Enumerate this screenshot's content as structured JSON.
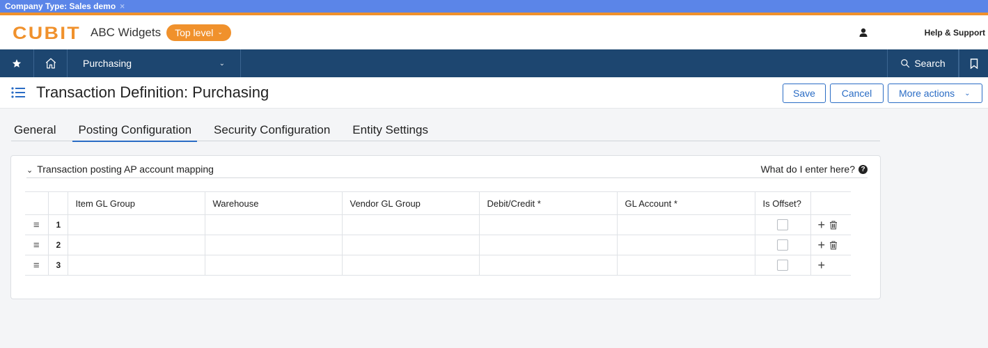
{
  "banner": {
    "text": "Company Type: Sales demo",
    "close": "×"
  },
  "header": {
    "logo": "CUBIT",
    "company": "ABC Widgets",
    "level": "Top level",
    "help": "Help & Support"
  },
  "nav": {
    "module": "Purchasing",
    "search": "Search"
  },
  "page": {
    "title": "Transaction Definition: Purchasing",
    "actions": {
      "save": "Save",
      "cancel": "Cancel",
      "more": "More actions"
    }
  },
  "tabs": [
    "General",
    "Posting Configuration",
    "Security Configuration",
    "Entity Settings"
  ],
  "active_tab": "Posting Configuration",
  "panel": {
    "title": "Transaction posting AP account mapping",
    "help": "What do I enter here?",
    "columns": [
      "Item GL Group",
      "Warehouse",
      "Vendor GL Group",
      "Debit/Credit *",
      "GL Account *",
      "Is Offset?"
    ],
    "rows": [
      {
        "num": "1",
        "deletable": true
      },
      {
        "num": "2",
        "deletable": true
      },
      {
        "num": "3",
        "deletable": false
      }
    ]
  },
  "colors": {
    "banner": "#5b85e8",
    "accent_orange": "#f0912c",
    "nav": "#1d4670",
    "primary": "#2a6cc5"
  },
  "icons": [
    "close-icon",
    "user-icon",
    "star-icon",
    "home-icon",
    "chevron-down-icon",
    "search-icon",
    "bookmark-icon",
    "list-icon",
    "question-icon",
    "drag-handle-icon",
    "plus-icon",
    "trash-icon"
  ]
}
